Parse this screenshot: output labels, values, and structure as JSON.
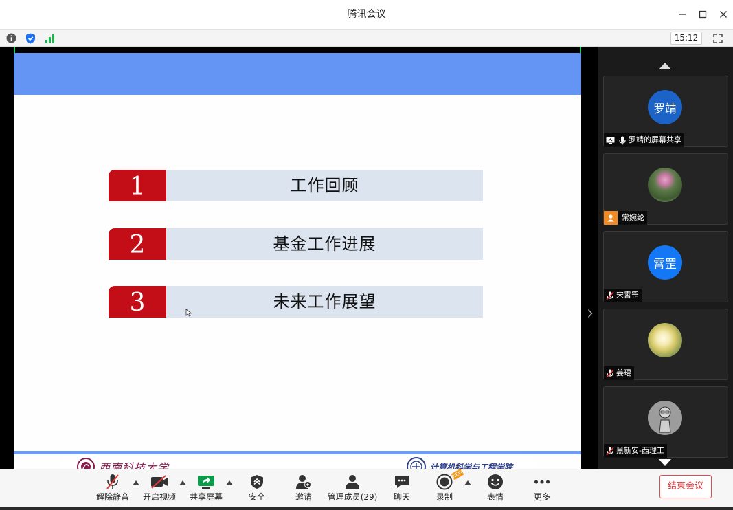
{
  "window": {
    "title": "腾讯会议"
  },
  "status": {
    "clock": "15:12"
  },
  "slide": {
    "agenda": [
      {
        "num": "1",
        "label": "工作回顾"
      },
      {
        "num": "2",
        "label": "基金工作进展"
      },
      {
        "num": "3",
        "label": "未来工作展望"
      }
    ],
    "footer_left_logo": "西南科技大学",
    "footer_right_logo": "计算机科学与工程学院",
    "accent_color": "#6495f4",
    "number_color": "#c30d17"
  },
  "participants": [
    {
      "name": "罗靖的屏幕共享",
      "avatar_text": "罗靖",
      "avatar_color": "#1c63c7",
      "badge": "screen-share"
    },
    {
      "name": "常婉纶",
      "avatar_text": "",
      "avatar_color": "#7a8a6a",
      "badge": "user"
    },
    {
      "name": "宋霄罡",
      "avatar_text": "霄罡",
      "avatar_color": "#1477f5",
      "badge": "mic-muted"
    },
    {
      "name": "姜琨",
      "avatar_text": "",
      "avatar_color": "#d9d2a8",
      "badge": "mic-muted"
    },
    {
      "name": "黑新安-西理工",
      "avatar_text": "",
      "avatar_color": "#9a9a9a",
      "badge": "mic-muted"
    }
  ],
  "toolbar": {
    "unmute": "解除静音",
    "video": "开启视频",
    "share": "共享屏幕",
    "security": "安全",
    "invite": "邀请",
    "members": "管理成员(29)",
    "chat": "聊天",
    "record": "录制",
    "reactions": "表情",
    "more": "更多",
    "end": "结束会议",
    "new_badge": "NEW"
  }
}
